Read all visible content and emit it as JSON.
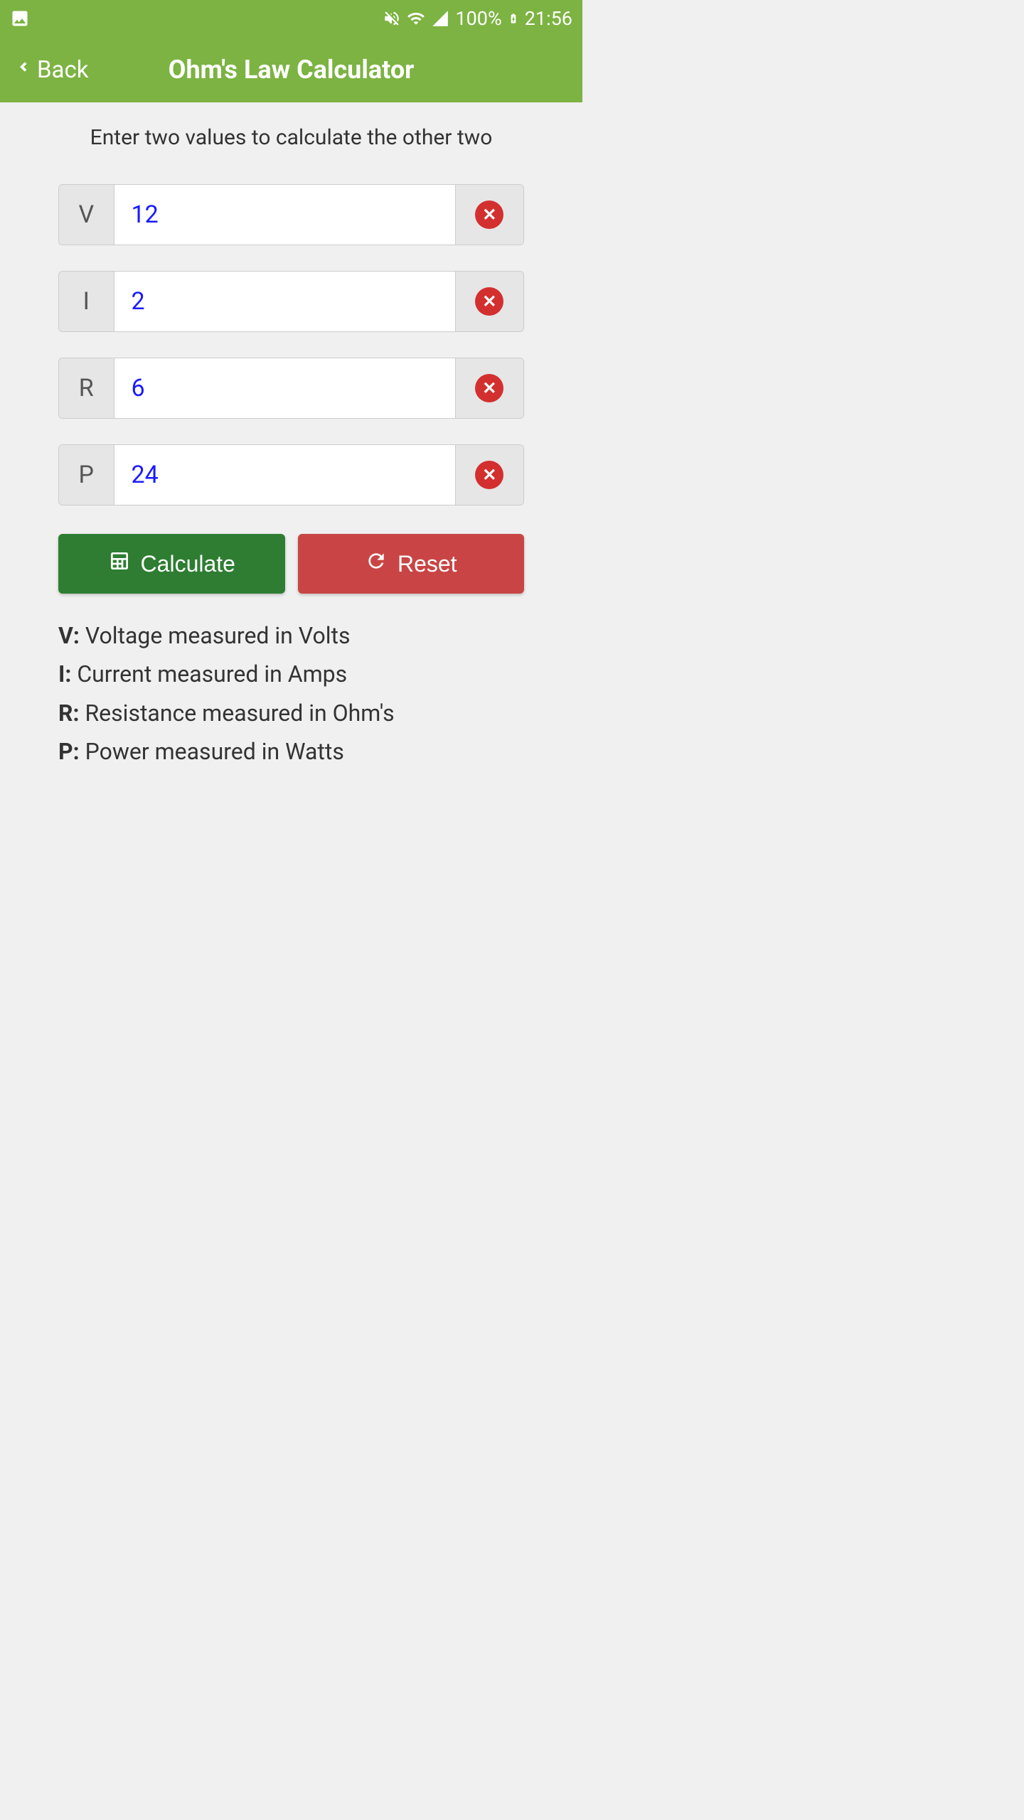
{
  "status_bar": {
    "battery_percent": "100%",
    "time": "21:56"
  },
  "app_bar": {
    "back_label": "Back",
    "title": "Ohm's Law Calculator"
  },
  "instruction": "Enter two values to calculate the other two",
  "inputs": {
    "voltage": {
      "label": "V",
      "value": "12"
    },
    "current": {
      "label": "I",
      "value": "2"
    },
    "resistance": {
      "label": "R",
      "value": "6"
    },
    "power": {
      "label": "P",
      "value": "24"
    }
  },
  "buttons": {
    "calculate": "Calculate",
    "reset": "Reset"
  },
  "legend": {
    "v_letter": "V:",
    "v_text": " Voltage measured in Volts",
    "i_letter": "I:",
    "i_text": " Current measured in Amps",
    "r_letter": "R:",
    "r_text": " Resistance measured in Ohm's",
    "p_letter": "P:",
    "p_text": " Power measured in Watts"
  }
}
